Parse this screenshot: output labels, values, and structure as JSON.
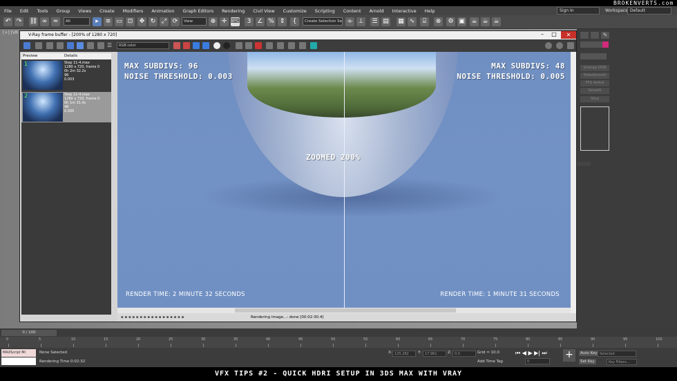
{
  "app": {
    "logo": "BROKENVERTS.com",
    "menu": [
      "File",
      "Edit",
      "Tools",
      "Group",
      "Views",
      "Create",
      "Modifiers",
      "Animation",
      "Graph Editors",
      "Rendering",
      "Civil View",
      "Customize",
      "Scripting",
      "Content",
      "Arnold",
      "Interactive",
      "Help"
    ],
    "signin": "Sign In",
    "workspaces_label": "Workspaces:",
    "workspaces_value": "Default",
    "toolbar": {
      "filter_value": "All",
      "view_value": "View",
      "selection_set_placeholder": "Create Selection Se"
    },
    "viewport_label": "[+] [VR"
  },
  "modifier_list": [
    "Unwrap UVW",
    "TurboSmooth",
    "FFD 4x4x4",
    "Smooth",
    "Slice"
  ],
  "vfb": {
    "title": "V-Ray frame buffer - [200% of 1280 x 720]",
    "channel_value": "RGB color",
    "history_headers": [
      "Preview",
      "Details"
    ],
    "history": [
      {
        "index": "1",
        "lines": [
          "Step 11-4.max",
          "1280 x 720, frame 0",
          "0h 2m 32.2s",
          "96",
          "0.003"
        ]
      },
      {
        "index": "2",
        "lines": [
          "Step 11-4.max",
          "1280 x 720, frame 0",
          "0h 1m 31.4s",
          "48",
          "0.005"
        ]
      }
    ],
    "left_overlay": {
      "line1": "MAX SUBDIVS: 96",
      "line2": "NOISE THRESHOLD: 0.003",
      "render_time": "RENDER TIME: 2 MINUTE 32 SECONDS"
    },
    "right_overlay": {
      "line1": "MAX SUBDIVS: 48",
      "line2": "NOISE THRESHOLD: 0.005",
      "render_time": "RENDER TIME: 1 MINUTE 31 SECONDS"
    },
    "center_overlay": "ZOOMED 200%",
    "status": "Rendering image...: done [00:02:30.4]"
  },
  "timeline": {
    "slider": "0 / 100",
    "ticks": [
      "0",
      "5",
      "10",
      "15",
      "20",
      "25",
      "30",
      "35",
      "40",
      "45",
      "50",
      "55",
      "60",
      "65",
      "70",
      "75",
      "80",
      "85",
      "90",
      "95",
      "100"
    ]
  },
  "status_bar": {
    "maxscript": "MAXScript Mi",
    "selection": "None Selected",
    "render_time": "Rendering Time  0:02:32",
    "x_label": "X:",
    "x_value": "125.282",
    "y_label": "Y:",
    "y_value": "17.961",
    "z_label": "Z:",
    "z_value": "0.0",
    "grid": "Grid = 10.0",
    "add_time_tag": "Add Time Tag",
    "auto_key": "Auto Key",
    "set_key": "Set Key",
    "selected": "Selected",
    "key_filters": "Key Filters...",
    "frame_value": "0"
  },
  "caption": "VFX TIPS #2 - QUICK HDRI SETUP IN 3DS MAX WITH VRAY"
}
